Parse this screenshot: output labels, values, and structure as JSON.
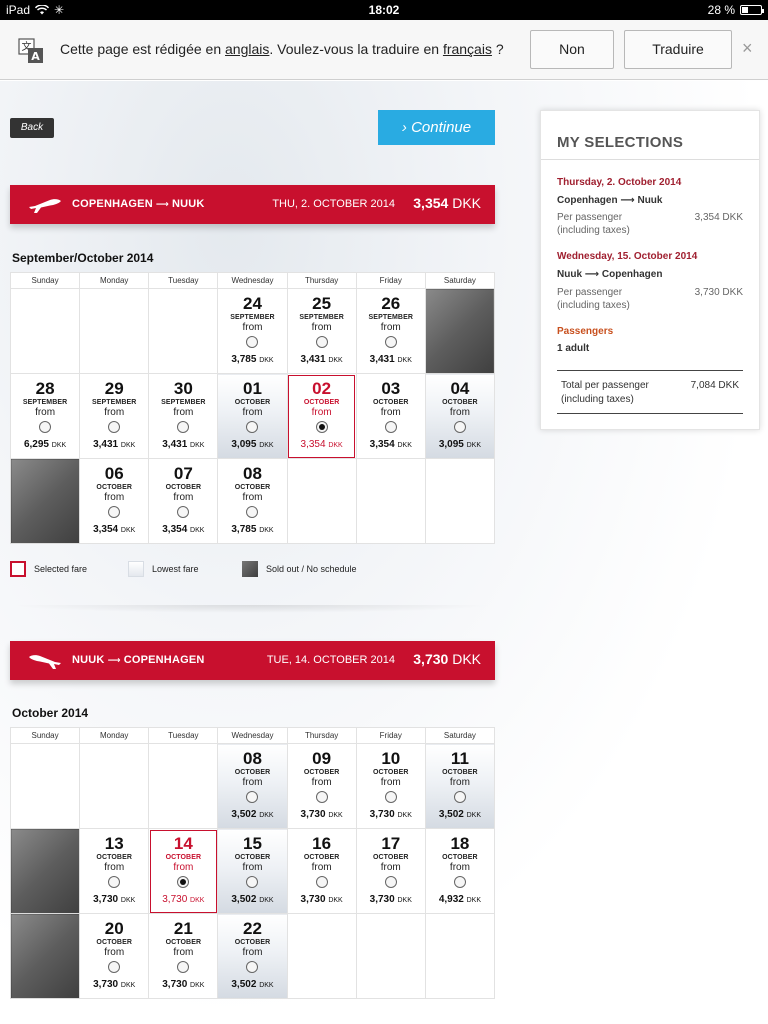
{
  "status_bar": {
    "device": "iPad",
    "time": "18:02",
    "battery": "28 %"
  },
  "translate_bar": {
    "message_before": "Cette page est rédigée en ",
    "source_lang": "anglais",
    "message_middle": ". Voulez-vous la traduire en ",
    "target_lang": "français",
    "message_after": " ?",
    "no_label": "Non",
    "translate_label": "Traduire",
    "close_glyph": "×"
  },
  "nav": {
    "back_label": "Back",
    "continue_label": "Continue",
    "continue_glyph": "›"
  },
  "outbound": {
    "route_from": "COPENHAGEN",
    "route_to": "NUUK",
    "arrow": "⟶",
    "date": "THU, 2. OCTOBER 2014",
    "price_value": "3,354",
    "currency": "DKK",
    "month_title": "September/October 2014"
  },
  "return": {
    "route_from": "NUUK",
    "route_to": "COPENHAGEN",
    "arrow": "⟶",
    "date": "TUE, 14. OCTOBER 2014",
    "price_value": "3,730",
    "currency": "DKK",
    "month_title": "October 2014"
  },
  "weekdays": [
    "Sunday",
    "Monday",
    "Tuesday",
    "Wednesday",
    "Thursday",
    "Friday",
    "Saturday"
  ],
  "cal_labels": {
    "from": "from",
    "currency": "DKK"
  },
  "cal1": {
    "r1": [
      {
        "day": "24",
        "month": "SEPTEMBER",
        "price": "3,785"
      },
      {
        "day": "25",
        "month": "SEPTEMBER",
        "price": "3,431"
      },
      {
        "day": "26",
        "month": "SEPTEMBER",
        "price": "3,431"
      }
    ],
    "r2": [
      {
        "day": "28",
        "month": "SEPTEMBER",
        "price": "6,295"
      },
      {
        "day": "29",
        "month": "SEPTEMBER",
        "price": "3,431"
      },
      {
        "day": "30",
        "month": "SEPTEMBER",
        "price": "3,431"
      },
      {
        "day": "01",
        "month": "OCTOBER",
        "price": "3,095"
      },
      {
        "day": "02",
        "month": "OCTOBER",
        "price": "3,354"
      },
      {
        "day": "03",
        "month": "OCTOBER",
        "price": "3,354"
      },
      {
        "day": "04",
        "month": "OCTOBER",
        "price": "3,095"
      }
    ],
    "r3": [
      {
        "day": "06",
        "month": "OCTOBER",
        "price": "3,354"
      },
      {
        "day": "07",
        "month": "OCTOBER",
        "price": "3,354"
      },
      {
        "day": "08",
        "month": "OCTOBER",
        "price": "3,785"
      }
    ]
  },
  "cal2": {
    "r1": [
      {
        "day": "08",
        "month": "OCTOBER",
        "price": "3,502"
      },
      {
        "day": "09",
        "month": "OCTOBER",
        "price": "3,730"
      },
      {
        "day": "10",
        "month": "OCTOBER",
        "price": "3,730"
      },
      {
        "day": "11",
        "month": "OCTOBER",
        "price": "3,502"
      }
    ],
    "r2": [
      {
        "day": "13",
        "month": "OCTOBER",
        "price": "3,730"
      },
      {
        "day": "14",
        "month": "OCTOBER",
        "price": "3,730"
      },
      {
        "day": "15",
        "month": "OCTOBER",
        "price": "3,502"
      },
      {
        "day": "16",
        "month": "OCTOBER",
        "price": "3,730"
      },
      {
        "day": "17",
        "month": "OCTOBER",
        "price": "3,730"
      },
      {
        "day": "18",
        "month": "OCTOBER",
        "price": "4,932"
      }
    ],
    "r3": [
      {
        "day": "20",
        "month": "OCTOBER",
        "price": "3,730"
      },
      {
        "day": "21",
        "month": "OCTOBER",
        "price": "3,730"
      },
      {
        "day": "22",
        "month": "OCTOBER",
        "price": "3,502"
      }
    ]
  },
  "legend": {
    "selected": "Selected fare",
    "lowest": "Lowest fare",
    "sold_out": "Sold out / No schedule"
  },
  "selections": {
    "title": "MY SELECTIONS",
    "outbound_date": "Thursday, 2. October 2014",
    "outbound_from": "Copenhagen",
    "outbound_to": "Nuuk",
    "per_passenger": "Per passenger",
    "including_taxes": "(including taxes)",
    "outbound_price": "3,354 DKK",
    "return_date": "Wednesday, 15. October 2014",
    "return_from": "Nuuk",
    "return_to": "Copenhagen",
    "return_price": "3,730 DKK",
    "passengers_label": "Passengers",
    "passengers_value": "1 adult",
    "total_label": "Total per passenger",
    "total_price": "7,084 DKK",
    "route_arrow": "⟶"
  },
  "colors": {
    "brand_red": "#c8102e",
    "continue_blue": "#29abe2",
    "sold_out": "#5d5d5d"
  },
  "icons": [
    "translate-icon",
    "wifi-icon",
    "airplane-icon",
    "close-icon",
    "battery-icon"
  ]
}
